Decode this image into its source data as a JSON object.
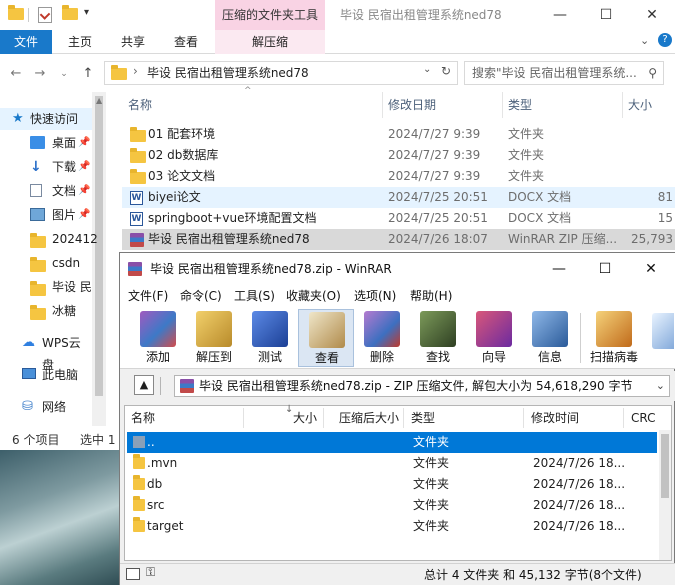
{
  "explorer": {
    "context_tab_header": "压缩的文件夹工具",
    "window_title": "毕设 民宿出租管理系统ned78",
    "ribbon_tabs": {
      "file": "文件",
      "home": "主页",
      "share": "共享",
      "view": "查看",
      "extract": "解压缩"
    },
    "address": {
      "path_segment": "毕设 民宿出租管理系统ned78"
    },
    "search": {
      "placeholder": "搜索\"毕设 民宿出租管理系统..."
    },
    "nav_pane": [
      {
        "label": "快速访问",
        "icon": "star-icon"
      },
      {
        "label": "桌面",
        "icon": "desktop-icon"
      },
      {
        "label": "下载",
        "icon": "download-icon"
      },
      {
        "label": "文档",
        "icon": "document-icon"
      },
      {
        "label": "图片",
        "icon": "picture-icon"
      },
      {
        "label": "202412",
        "icon": "folder-icon"
      },
      {
        "label": "csdn",
        "icon": "folder-icon"
      },
      {
        "label": "毕设 民",
        "icon": "folder-icon"
      },
      {
        "label": "冰糖",
        "icon": "folder-icon"
      },
      {
        "label": "WPS云盘",
        "icon": "cloud-icon"
      },
      {
        "label": "此电脑",
        "icon": "computer-icon"
      },
      {
        "label": "网络",
        "icon": "network-icon"
      }
    ],
    "columns": {
      "name": "名称",
      "modified": "修改日期",
      "type": "类型",
      "size": "大小"
    },
    "files": [
      {
        "name": "01 配套环境",
        "modified": "2024/7/27 9:39",
        "type": "文件夹",
        "size": "",
        "icon": "folder-icon"
      },
      {
        "name": "02 db数据库",
        "modified": "2024/7/27 9:39",
        "type": "文件夹",
        "size": "",
        "icon": "folder-icon"
      },
      {
        "name": "03 论文文档",
        "modified": "2024/7/27 9:39",
        "type": "文件夹",
        "size": "",
        "icon": "folder-icon"
      },
      {
        "name": "biyei论文",
        "modified": "2024/7/25 20:51",
        "type": "DOCX 文档",
        "size": "81",
        "icon": "docx-icon"
      },
      {
        "name": "springboot+vue环境配置文档",
        "modified": "2024/7/25 20:51",
        "type": "DOCX 文档",
        "size": "15",
        "icon": "docx-icon"
      },
      {
        "name": "毕设 民宿出租管理系统ned78",
        "modified": "2024/7/26 18:07",
        "type": "WinRAR ZIP 压缩...",
        "size": "25,793",
        "icon": "winrar-icon"
      }
    ],
    "status": {
      "items": "6 个项目",
      "selected": "选中 1"
    }
  },
  "winrar": {
    "title": "毕设 民宿出租管理系统ned78.zip - WinRAR",
    "menu": [
      "文件(F)",
      "命令(C)",
      "工具(S)",
      "收藏夹(O)",
      "选项(N)",
      "帮助(H)"
    ],
    "toolbar": [
      {
        "label": "添加",
        "icon": "add-archive-icon",
        "color": "#7b3f8f"
      },
      {
        "label": "解压到",
        "icon": "extract-to-icon",
        "color": "#c9a23a"
      },
      {
        "label": "测试",
        "icon": "test-icon",
        "color": "#2a56b8"
      },
      {
        "label": "查看",
        "icon": "view-icon",
        "color": "#b08a4a"
      },
      {
        "label": "删除",
        "icon": "delete-icon",
        "color": "#8a4aa8"
      },
      {
        "label": "查找",
        "icon": "find-icon",
        "color": "#4f6b3a"
      },
      {
        "label": "向导",
        "icon": "wizard-icon",
        "color": "#a8334a"
      },
      {
        "label": "信息",
        "icon": "info-icon",
        "color": "#3a6fb0"
      },
      {
        "label": "扫描病毒",
        "icon": "scan-virus-icon",
        "color": "#d08a2a"
      }
    ],
    "path": "毕设 民宿出租管理系统ned78.zip - ZIP 压缩文件, 解包大小为 54,618,290 字节",
    "columns": {
      "name": "名称",
      "size": "大小",
      "packed": "压缩后大小",
      "type": "类型",
      "modified": "修改时间",
      "crc": "CRC"
    },
    "rows": [
      {
        "name": "..",
        "type": "文件夹",
        "modified": "",
        "icon": "parent-folder-icon"
      },
      {
        "name": ".mvn",
        "type": "文件夹",
        "modified": "2024/7/26 18...",
        "icon": "folder-icon"
      },
      {
        "name": "db",
        "type": "文件夹",
        "modified": "2024/7/26 18...",
        "icon": "folder-icon"
      },
      {
        "name": "src",
        "type": "文件夹",
        "modified": "2024/7/26 18...",
        "icon": "folder-icon"
      },
      {
        "name": "target",
        "type": "文件夹",
        "modified": "2024/7/26 18...",
        "icon": "folder-icon"
      }
    ],
    "status": "总计 4 文件夹 和 45,132 字节(8个文件)"
  },
  "colors": {
    "accent": "#1979ca",
    "selection": "#0078d7",
    "context_tab": "#f9d3e4",
    "folder": "#f5c541"
  }
}
